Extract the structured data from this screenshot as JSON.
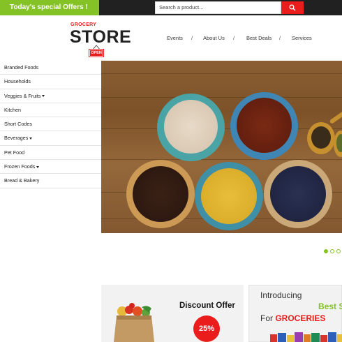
{
  "topbar": {
    "offers_label": "Today's special Offers !",
    "search_placeholder": "Search a product...",
    "search_icon": "search-icon"
  },
  "logo": {
    "top_text": "GROCERY",
    "main_text": "STORE",
    "sign_text": "OPEN"
  },
  "nav": {
    "items": [
      "Events",
      "About Us",
      "Best Deals",
      "Services"
    ],
    "separator": "/"
  },
  "sidebar": {
    "items": [
      {
        "label": "Branded Foods",
        "has_dropdown": false
      },
      {
        "label": "Households",
        "has_dropdown": false
      },
      {
        "label": "Veggies & Fruits",
        "has_dropdown": true
      },
      {
        "label": "Kitchen",
        "has_dropdown": false
      },
      {
        "label": "Short Codes",
        "has_dropdown": false
      },
      {
        "label": "Beverages",
        "has_dropdown": true
      },
      {
        "label": "Pet Food",
        "has_dropdown": false
      },
      {
        "label": "Frozen Foods",
        "has_dropdown": true
      },
      {
        "label": "Bread & Bakery",
        "has_dropdown": false
      }
    ]
  },
  "slider": {
    "slide_count": 3,
    "active_index": 0
  },
  "promo1": {
    "title": "Discount Offer",
    "badge": "25%"
  },
  "promo2": {
    "line1": "Introducing",
    "line2": "Best S",
    "line3_prefix": "For ",
    "line3_highlight": "GROCERIES"
  },
  "colors": {
    "accent_green": "#84c225",
    "accent_red": "#ea1c1c",
    "topbar_bg": "#212121"
  }
}
